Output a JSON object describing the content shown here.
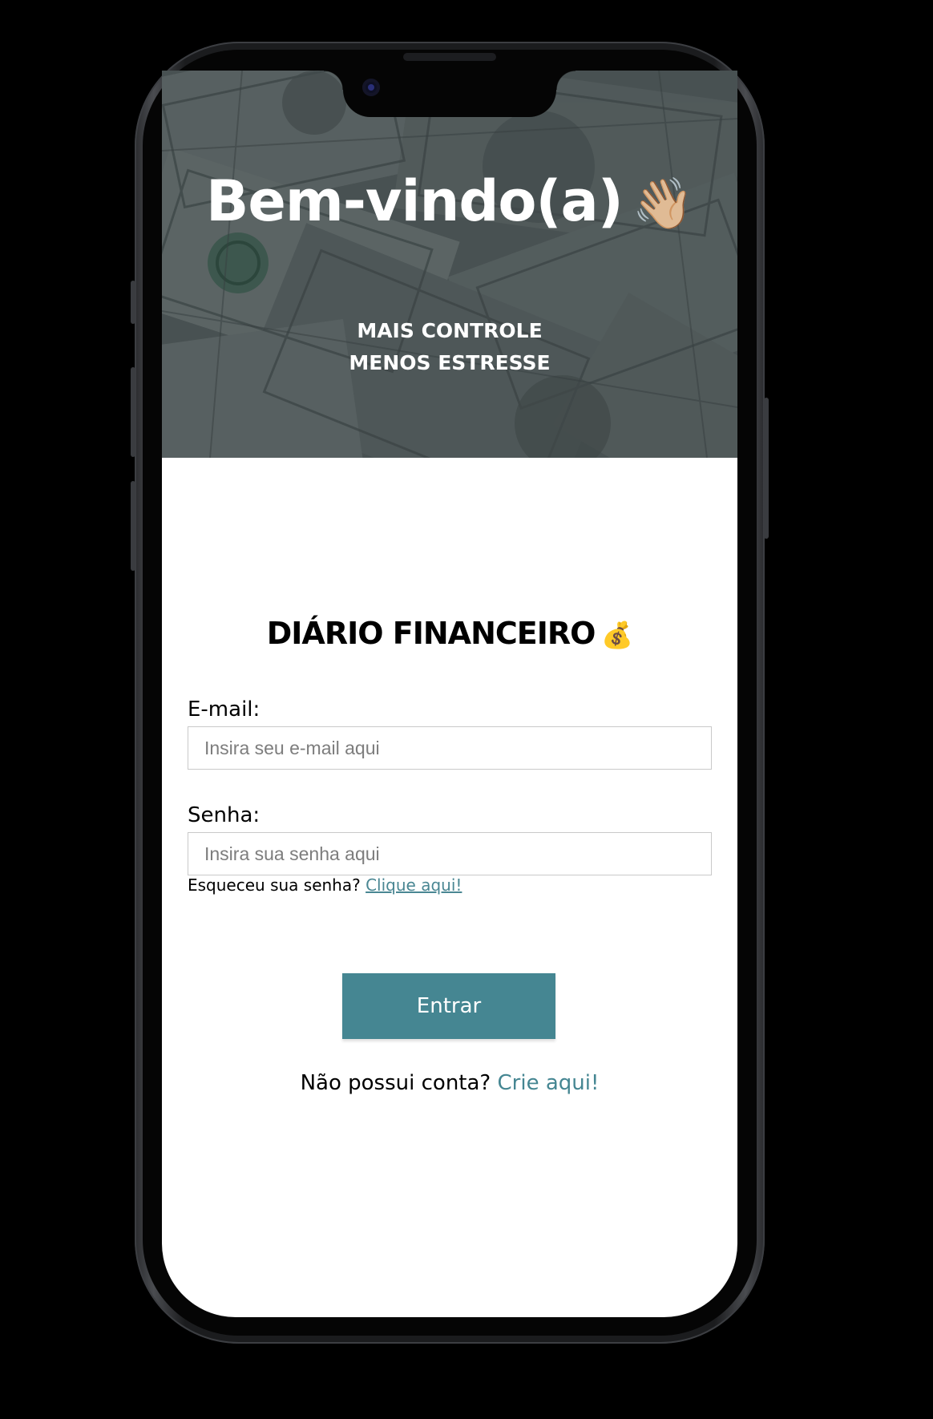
{
  "hero": {
    "title": "Bem-vindo(a)",
    "title_emoji": "👋🏼",
    "subtitle_line1": "MAIS CONTROLE",
    "subtitle_line2": "MENOS ESTRESSE"
  },
  "app": {
    "title": "DIÁRIO FINANCEIRO",
    "title_emoji": "💰"
  },
  "form": {
    "email_label": "E-mail:",
    "email_placeholder": "Insira seu e-mail aqui",
    "email_value": "",
    "password_label": "Senha:",
    "password_placeholder": "Insira sua senha aqui",
    "password_value": "",
    "forgot_text": "Esqueceu sua senha?",
    "forgot_link": "Clique aqui!",
    "submit_label": "Entrar",
    "signup_text": "Não possui conta?",
    "signup_link": "Crie aqui!"
  },
  "colors": {
    "accent": "#458692",
    "link": "#4a8793",
    "background": "#ffffff",
    "device_bg": "#000000"
  }
}
